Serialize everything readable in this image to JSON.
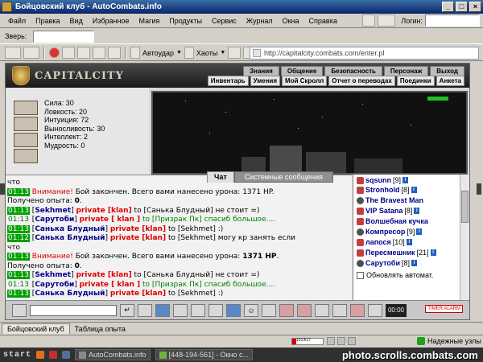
{
  "window": {
    "title": "Бойцовский клуб - AutoCombats.info"
  },
  "menu": {
    "items": [
      "Файл",
      "Правка",
      "Вид",
      "Избранное",
      "Магия",
      "Продукты",
      "Сервис",
      "Журнал",
      "Окна",
      "Справка"
    ],
    "login_label": "Логин:"
  },
  "toolbar": {
    "beast_label": "Зверь:",
    "autoattack_label": "Автоудар",
    "chaos_label": "Хаоты"
  },
  "address": {
    "url": "http://capitalcity.combats.com/enter.pl"
  },
  "game": {
    "logo_text": "CAPITALCITY",
    "nav_top": [
      "Знания",
      "Общение",
      "Безопасность",
      "Персонаж",
      "Выход"
    ],
    "nav_sub": [
      "Инвентарь",
      "Умения",
      "Мой Скролл",
      "Отчет о переводах",
      "Поединки",
      "Анкета"
    ],
    "stats": [
      "Сила: 30",
      "Ловкость: 20",
      "Интуиция: 72",
      "Выносливость: 30",
      "Интеллект: 2",
      "Мудрость: 0"
    ],
    "tabs": {
      "chat": "Чат",
      "system": "Системные сообщения"
    },
    "chat": [
      {
        "parts": [
          {
            "c": "plain",
            "t": "что"
          }
        ]
      },
      {
        "parts": [
          {
            "c": "time",
            "t": "01:13"
          },
          {
            "c": "warn",
            "t": " Внимание!"
          },
          {
            "c": "plain",
            "t": " Бой закончен. Всего вами нанесено урона: 1371 HP."
          }
        ]
      },
      {
        "parts": [
          {
            "c": "plain",
            "t": "Получено опыта: "
          },
          {
            "c": "bold",
            "t": "0"
          },
          {
            "c": "plain",
            "t": "."
          }
        ]
      },
      {
        "parts": [
          {
            "c": "time",
            "t": "01:13"
          },
          {
            "c": "plain",
            "t": " ["
          },
          {
            "c": "nick",
            "t": "Sekhmet"
          },
          {
            "c": "plain",
            "t": "] "
          },
          {
            "c": "priv",
            "t": "private [klan]"
          },
          {
            "c": "plain",
            "t": " to [Санька Блудный] не стоит =)"
          }
        ]
      },
      {
        "parts": [
          {
            "c": "timeg",
            "t": "01:13"
          },
          {
            "c": "plain",
            "t": " ["
          },
          {
            "c": "nick",
            "t": "Сарутоби"
          },
          {
            "c": "plain",
            "t": "] "
          },
          {
            "c": "priv",
            "t": "private [ klan ]"
          },
          {
            "c": "grn",
            "t": " to [Призрак Пк] спасиб большое...."
          }
        ]
      },
      {
        "parts": [
          {
            "c": "time",
            "t": "01:13"
          },
          {
            "c": "plain",
            "t": " ["
          },
          {
            "c": "nick",
            "t": "Санька Блудный"
          },
          {
            "c": "plain",
            "t": "] "
          },
          {
            "c": "priv",
            "t": "private [klan]"
          },
          {
            "c": "plain",
            "t": " to [Sekhmet] :)"
          }
        ]
      },
      {
        "parts": [
          {
            "c": "time",
            "t": "01:12"
          },
          {
            "c": "plain",
            "t": " ["
          },
          {
            "c": "nick",
            "t": "Санька Блудный"
          },
          {
            "c": "plain",
            "t": "] "
          },
          {
            "c": "priv",
            "t": "private [klan]"
          },
          {
            "c": "plain",
            "t": " to [Sekhmet] могу кр занять если"
          }
        ]
      },
      {
        "parts": [
          {
            "c": "plain",
            "t": "что"
          }
        ]
      },
      {
        "parts": [
          {
            "c": "time",
            "t": "01:13"
          },
          {
            "c": "warn",
            "t": " Внимание!"
          },
          {
            "c": "plain",
            "t": " Бой закончен. Всего вами нанесено урона: "
          },
          {
            "c": "bold",
            "t": "1371 HP"
          },
          {
            "c": "plain",
            "t": "."
          }
        ]
      },
      {
        "parts": [
          {
            "c": "plain",
            "t": "Получено опыта: "
          },
          {
            "c": "bold",
            "t": "0"
          },
          {
            "c": "plain",
            "t": "."
          }
        ]
      },
      {
        "parts": [
          {
            "c": "time",
            "t": "01:13"
          },
          {
            "c": "plain",
            "t": " ["
          },
          {
            "c": "nick",
            "t": "Sekhmet"
          },
          {
            "c": "plain",
            "t": "] "
          },
          {
            "c": "priv",
            "t": "private [klan]"
          },
          {
            "c": "plain",
            "t": " to [Санька Блудный] не стоит =)"
          }
        ]
      },
      {
        "parts": [
          {
            "c": "timeg",
            "t": "01:13"
          },
          {
            "c": "plain",
            "t": " ["
          },
          {
            "c": "nick",
            "t": "Сарутоби"
          },
          {
            "c": "plain",
            "t": "] "
          },
          {
            "c": "priv",
            "t": "private [ klan ]"
          },
          {
            "c": "grn",
            "t": " to [Призрак Пк] спасиб большое...."
          }
        ]
      },
      {
        "parts": [
          {
            "c": "time",
            "t": "01:13"
          },
          {
            "c": "plain",
            "t": " ["
          },
          {
            "c": "nick",
            "t": "Санька Блудный"
          },
          {
            "c": "plain",
            "t": "] "
          },
          {
            "c": "priv",
            "t": "private [klan]"
          },
          {
            "c": "plain",
            "t": " to [Sekhmet] :)"
          }
        ]
      }
    ],
    "users": [
      {
        "name": "sqsunn",
        "level": "[9]"
      },
      {
        "name": "Stronhold",
        "level": "[8]"
      },
      {
        "name": "The Bravest Man",
        "level": ""
      },
      {
        "name": "VIP Satana",
        "level": "[8]"
      },
      {
        "name": "Волшебная кучка",
        "level": ""
      },
      {
        "name": "Компресор",
        "level": "[9]"
      },
      {
        "name": "лапося",
        "level": "[10]"
      },
      {
        "name": "Пересмешник",
        "level": "[21]"
      },
      {
        "name": "Сарутоби",
        "level": "[8]"
      }
    ],
    "auto_refresh_label": "Обновлять автомат.",
    "clock": "00:00",
    "timer_label": "TIMER ALARM"
  },
  "bottom_tabs": [
    "Бойцовский клуб",
    "Таблица опыта"
  ],
  "status": {
    "meter_text": "101/617",
    "secure_label": "Надежные узлы"
  },
  "taskbar": {
    "start": "start",
    "tasks": [
      "AutoCombats.info",
      "[448-194-561] - Окно с..."
    ]
  },
  "watermark": "photo.scrolls.combats.com"
}
